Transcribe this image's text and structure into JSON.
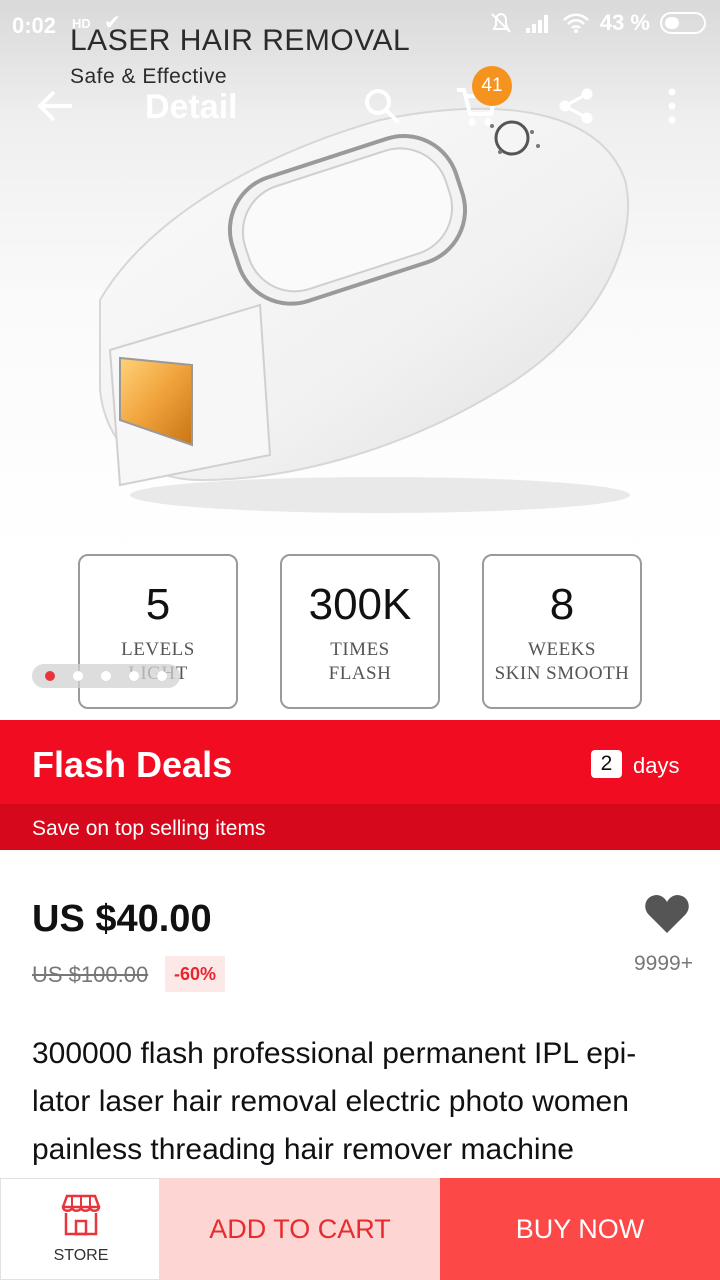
{
  "status_bar": {
    "time": "0:02",
    "hd_label": "HD",
    "battery": "43 %"
  },
  "top_nav": {
    "title": "Detail",
    "cart_count": "41",
    "icons": [
      "back-arrow-icon",
      "search-icon",
      "cart-icon",
      "share-icon",
      "more-vertical-icon"
    ]
  },
  "hero": {
    "banner_title": "LASER HAIR REMOVAL",
    "banner_subtitle": "Safe & Effective",
    "specs": [
      {
        "number": "5",
        "line1": "LEVELS",
        "line2": "LIGHT"
      },
      {
        "number": "300K",
        "line1": "TIMES",
        "line2": "FLASH"
      },
      {
        "number": "8",
        "line1": "WEEKS",
        "line2": "SKIN SMOOTH"
      }
    ],
    "carousel": {
      "total": 5,
      "active_index": 0
    }
  },
  "flash_deals": {
    "title": "Flash Deals",
    "days_count": "2",
    "days_label": "days",
    "subtitle": "Save on top selling items"
  },
  "product": {
    "price": "US $40.00",
    "original_price": "US $100.00",
    "discount": "-60%",
    "wishlist_count": "9999+",
    "title": "300000 flash professional permanent IPL epi-lator laser hair removal electric photo women painless threading hair remover machine"
  },
  "bottom_bar": {
    "store_label": "STORE",
    "add_to_cart_label": "ADD TO CART",
    "buy_now_label": "BUY NOW"
  },
  "colors": {
    "flash_red": "#f20c22",
    "flash_sub_red": "#d6091c",
    "buy_now_red": "#fc4847",
    "add_to_cart_bg": "#fdd5d3",
    "badge_orange": "#f6921e"
  }
}
